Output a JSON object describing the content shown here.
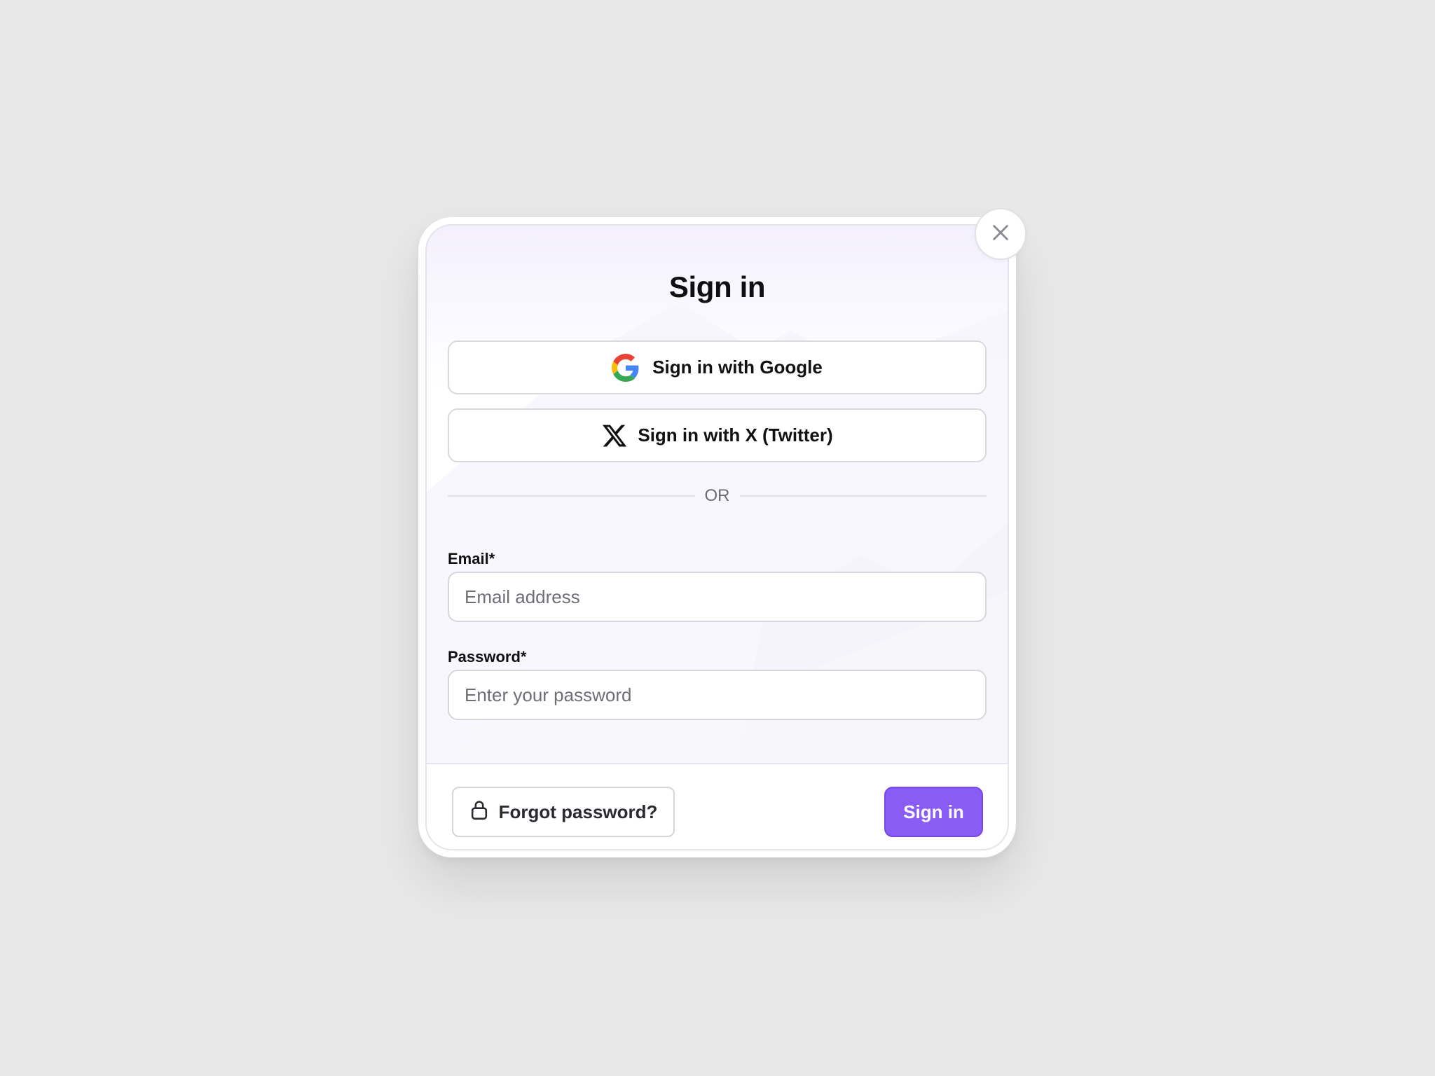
{
  "modal": {
    "title": "Sign in",
    "close_icon": "close-icon"
  },
  "social": {
    "google": {
      "label": "Sign in with Google",
      "icon": "google-icon",
      "colors": {
        "blue": "#4285F4",
        "red": "#EA4335",
        "yellow": "#FBBC05",
        "green": "#34A853"
      }
    },
    "x": {
      "label": "Sign in with X (Twitter)",
      "icon": "x-twitter-icon"
    }
  },
  "divider": {
    "text": "OR"
  },
  "form": {
    "email": {
      "label": "Email*",
      "placeholder": "Email address",
      "value": ""
    },
    "password": {
      "label": "Password*",
      "placeholder": "Enter your password",
      "value": ""
    }
  },
  "footer": {
    "forgot_label": "Forgot password?",
    "forgot_icon": "lock-icon",
    "signin_label": "Sign in"
  },
  "colors": {
    "accent": "#8a5cf6",
    "background": "#e8e8e8",
    "card_tint": "#f3f0fd"
  }
}
